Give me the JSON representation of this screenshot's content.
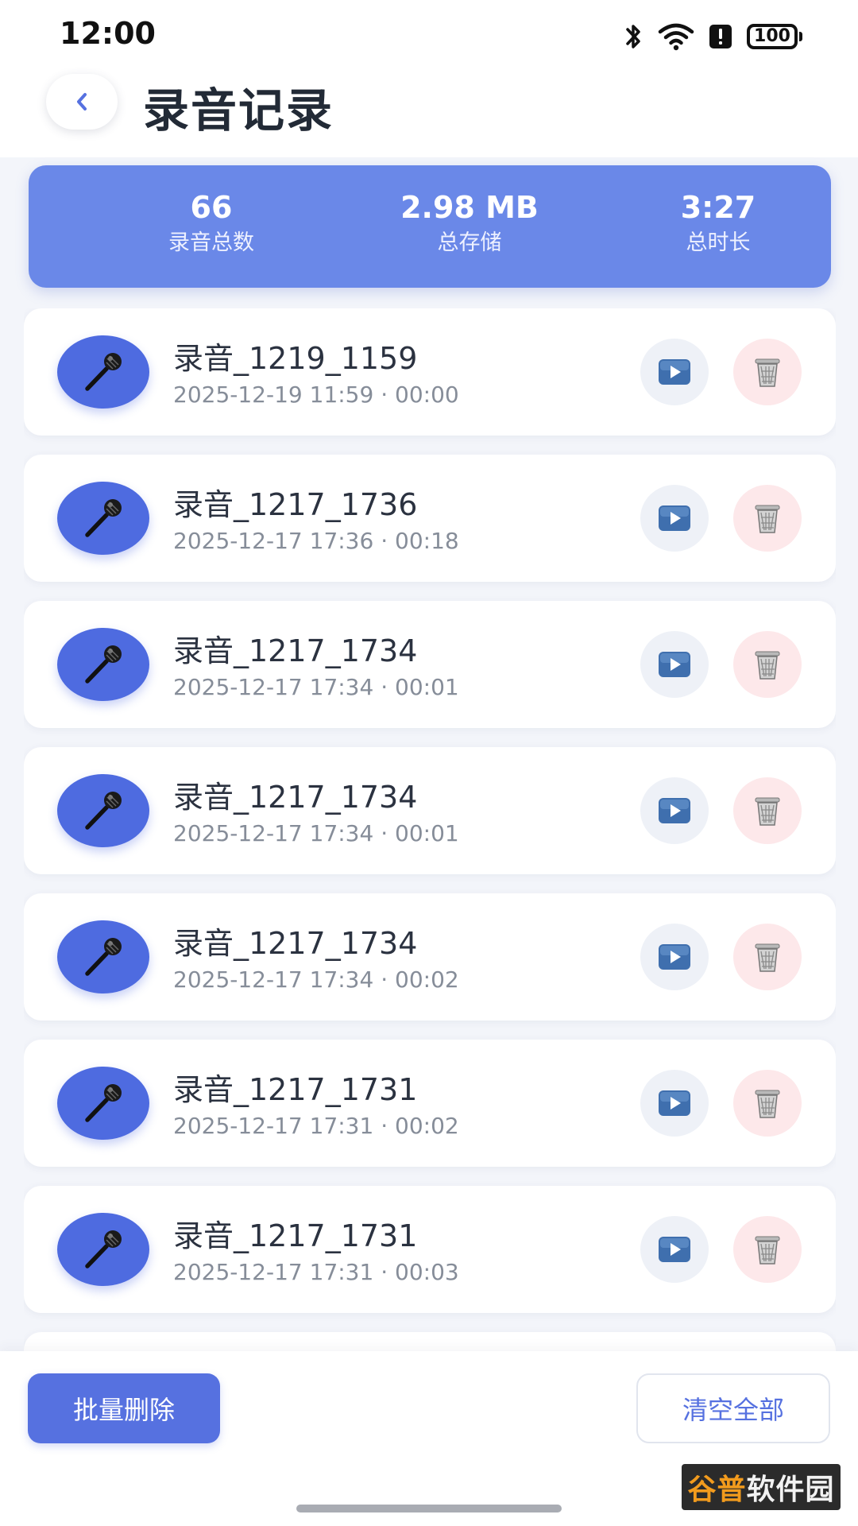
{
  "status_bar": {
    "time": "12:00",
    "battery": "100",
    "icons": [
      "bluetooth-icon",
      "wifi-icon",
      "alert-icon",
      "battery-icon"
    ]
  },
  "header": {
    "back_icon": "chevron-left-icon",
    "title": "录音记录"
  },
  "summary": {
    "total_count": "66",
    "total_count_label": "录音总数",
    "total_storage": "2.98 MB",
    "total_storage_label": "总存储",
    "total_duration": "3:27",
    "total_duration_label": "总时长"
  },
  "recordings": [
    {
      "name": "录音_1219_1159",
      "meta": "2025-12-19 11:59 · 00:00"
    },
    {
      "name": "录音_1217_1736",
      "meta": "2025-12-17 17:36 · 00:18"
    },
    {
      "name": "录音_1217_1734",
      "meta": "2025-12-17 17:34 · 00:01"
    },
    {
      "name": "录音_1217_1734",
      "meta": "2025-12-17 17:34 · 00:01"
    },
    {
      "name": "录音_1217_1734",
      "meta": "2025-12-17 17:34 · 00:02"
    },
    {
      "name": "录音_1217_1731",
      "meta": "2025-12-17 17:31 · 00:02"
    },
    {
      "name": "录音_1217_1731",
      "meta": "2025-12-17 17:31 · 00:03"
    },
    {
      "name": "",
      "meta": ""
    }
  ],
  "item_icons": {
    "avatar": "microphone-icon",
    "play": "play-icon",
    "delete": "trash-icon"
  },
  "bottom": {
    "batch_delete_label": "批量删除",
    "clear_all_label": "清空全部",
    "watermark_part1": "谷普",
    "watermark_part2": "软件园"
  },
  "colors": {
    "accent": "#5671e0",
    "summary_bg": "#6a88e8",
    "avatar_bg": "#4e6be0",
    "delete_bg": "#fde8ea",
    "play_bg": "#eef1f7",
    "page_bg": "#f3f5fa"
  }
}
